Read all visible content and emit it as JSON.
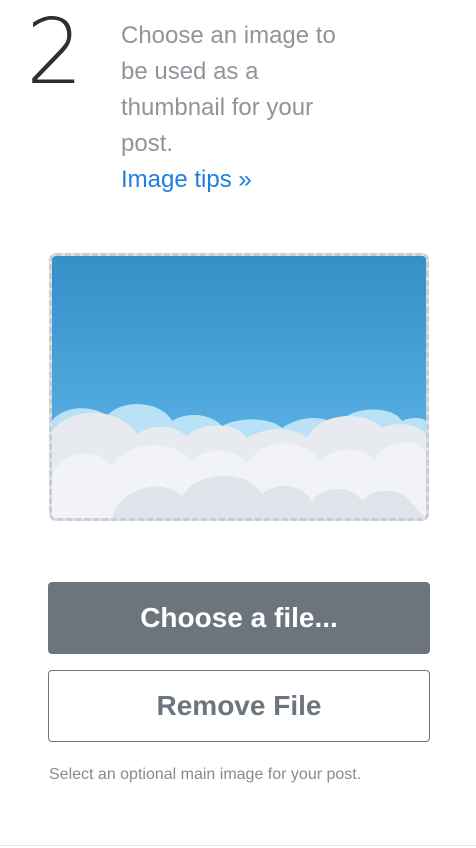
{
  "step": {
    "number": "2",
    "instruction": "Choose an image to be used as a thumbnail for your post.",
    "tips_link": "Image tips »"
  },
  "upload": {
    "preview_alt": "Sky with clouds thumbnail",
    "choose_label": "Choose a file...",
    "remove_label": "Remove File",
    "help_text": "Select an optional main image for your post."
  },
  "colors": {
    "step_number": "#2b2f33",
    "instruction_text": "#8f959a",
    "link": "#1d7fe0",
    "primary_button": "#6c757d",
    "dashed_border": "#c9cdd1"
  }
}
